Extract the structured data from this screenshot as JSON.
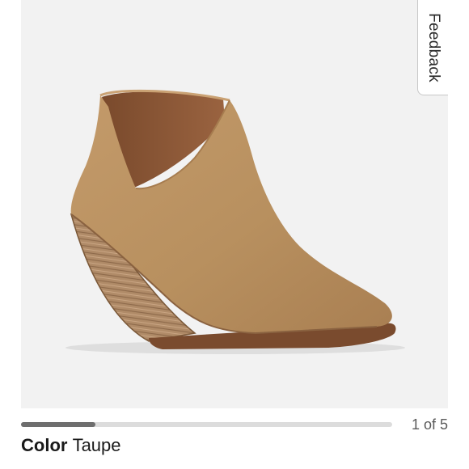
{
  "feedback": {
    "label": "Feedback"
  },
  "gallery": {
    "image_alt": "Taupe suede wedge ankle bootie",
    "progress": 0.2,
    "counter": "1 of 5",
    "background": "#f2f2f2"
  },
  "product": {
    "color_label": "Color",
    "color_value": "Taupe"
  },
  "colors": {
    "progress_fill": "#6e6e6e",
    "progress_track": "#dcdcdc"
  }
}
